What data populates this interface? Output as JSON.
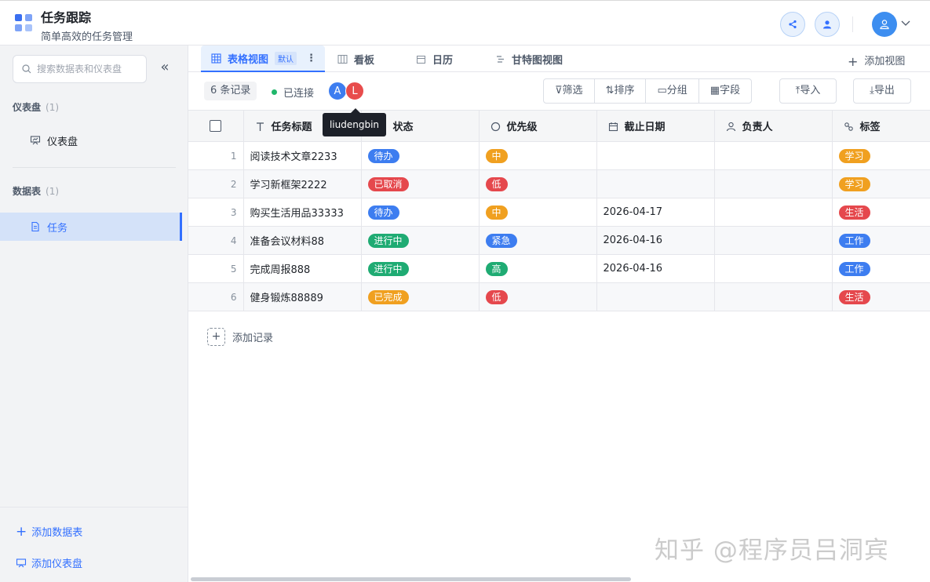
{
  "header": {
    "title": "任务跟踪",
    "subtitle": "简单高效的任务管理",
    "share_icon": "share-icon",
    "member_icon": "user-icon",
    "account_icon": "user-icon"
  },
  "sidebar": {
    "search_placeholder": "搜索数据表和仪表盘",
    "collapse_label": "«",
    "dashboards_title": "仪表盘",
    "dashboards_count": "(1)",
    "dashboards": [
      {
        "label": "仪表盘"
      }
    ],
    "tables_title": "数据表",
    "tables_count": "(1)",
    "tables": [
      {
        "label": "任务",
        "active": true
      }
    ],
    "add_table_label": "添加数据表",
    "add_dashboard_label": "添加仪表盘"
  },
  "tabs": {
    "items": [
      {
        "label": "表格视图",
        "badge": "默认",
        "more": "⋮",
        "active": true
      },
      {
        "label": "看板"
      },
      {
        "label": "日历"
      },
      {
        "label": "甘特图视图"
      }
    ],
    "add_view_label": "添加视图"
  },
  "toolbar": {
    "record_count": "6 条记录",
    "connection_status": "已连接",
    "users": [
      {
        "initial": "A",
        "color": "#3d7df0"
      },
      {
        "initial": "L",
        "color": "#e84c4c"
      }
    ],
    "tooltip": "liudengbin",
    "filter_label": "筛选",
    "sort_label": "排序",
    "group_label": "分组",
    "fields_label": "字段",
    "import_label": "导入",
    "export_label": "导出"
  },
  "table": {
    "columns": [
      "任务标题",
      "状态",
      "优先级",
      "截止日期",
      "负责人",
      "标签"
    ],
    "rows": [
      {
        "index": "1",
        "title": "阅读技术文章2233",
        "status": "待办",
        "priority": "中",
        "due": "",
        "owner": "",
        "tag": "学习"
      },
      {
        "index": "2",
        "title": "学习新框架2222",
        "status": "已取消",
        "priority": "低",
        "due": "",
        "owner": "",
        "tag": "学习"
      },
      {
        "index": "3",
        "title": "购买生活用品33333",
        "status": "待办",
        "priority": "中",
        "due": "2026-04-17",
        "owner": "",
        "tag": "生活"
      },
      {
        "index": "4",
        "title": "准备会议材料88",
        "status": "进行中",
        "priority": "紧急",
        "due": "2026-04-16",
        "owner": "",
        "tag": "工作"
      },
      {
        "index": "5",
        "title": "完成周报888",
        "status": "进行中",
        "priority": "高",
        "due": "2026-04-16",
        "owner": "",
        "tag": "工作"
      },
      {
        "index": "6",
        "title": "健身锻炼88889",
        "status": "已完成",
        "priority": "低",
        "due": "",
        "owner": "",
        "tag": "生活"
      }
    ],
    "add_record_label": "添加记录"
  },
  "colors": {
    "待办": "#3d7df0",
    "已取消": "#e5484d",
    "进行中": "#1fab73",
    "已完成": "#f0a020",
    "中": "#f0a020",
    "低": "#e5484d",
    "紧急": "#3d7df0",
    "高": "#1fab73",
    "学习": "#f0a020",
    "生活": "#e5484d",
    "工作": "#3d7df0"
  },
  "watermark": "知乎 @程序员吕洞宾"
}
